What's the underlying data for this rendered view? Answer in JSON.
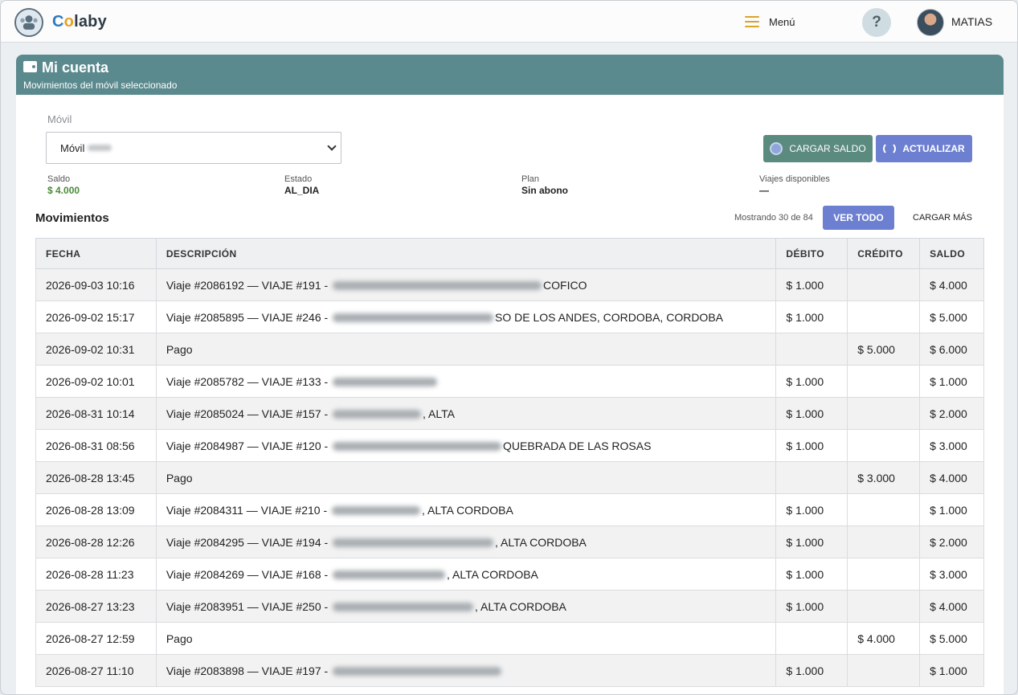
{
  "header": {
    "brand_c": "C",
    "brand_o": "o",
    "brand_rest": "laby",
    "menu_label": "Menú",
    "help_label": "?",
    "user_name": "MATIAS"
  },
  "card": {
    "title": "Mi cuenta",
    "subtitle": "Movimientos del móvil seleccionado",
    "field_label": "Móvil",
    "select_value": "Móvil",
    "charge_button": "CARGAR SALDO",
    "refresh_button": "ACTUALIZAR"
  },
  "stats": [
    {
      "label": "Saldo",
      "value": "$ 4.000"
    },
    {
      "label": "Estado",
      "value": "AL_DIA"
    },
    {
      "label": "Plan",
      "value": "Sin abono"
    },
    {
      "label": "Viajes disponibles",
      "value": "—"
    }
  ],
  "movements": {
    "title": "Movimientos",
    "showing": "Mostrando 30 de 84",
    "view_all": "VER TODO",
    "load_more": "CARGAR MÁS",
    "columns": [
      "FECHA",
      "DESCRIPCIÓN",
      "DÉBITO",
      "CRÉDITO",
      "SALDO"
    ],
    "rows": [
      {
        "date": "2026-09-03 10:16",
        "desc_pre": "Viaje #2086192 — VIAJE #191 - ",
        "desc_post": "COFICO",
        "debit": "$ 1.000",
        "credit": "",
        "balance": "$ 4.000"
      },
      {
        "date": "2026-09-02 15:17",
        "desc_pre": "Viaje #2085895 — VIAJE #246 - ",
        "desc_post": "SO DE LOS ANDES, CORDOBA, CORDOBA",
        "debit": "$ 1.000",
        "credit": "",
        "balance": "$ 5.000"
      },
      {
        "date": "2026-09-02 10:31",
        "desc_pre": "Pago",
        "desc_post": "",
        "debit": "",
        "credit": "$ 5.000",
        "balance": "$ 6.000"
      },
      {
        "date": "2026-09-02 10:01",
        "desc_pre": "Viaje #2085782 — VIAJE #133 - ",
        "desc_post": "",
        "debit": "$ 1.000",
        "credit": "",
        "balance": "$ 1.000"
      },
      {
        "date": "2026-08-31 10:14",
        "desc_pre": "Viaje #2085024 — VIAJE #157 - ",
        "desc_post": ", ALTA",
        "debit": "$ 1.000",
        "credit": "",
        "balance": "$ 2.000"
      },
      {
        "date": "2026-08-31 08:56",
        "desc_pre": "Viaje #2084987 — VIAJE #120 - ",
        "desc_post": "QUEBRADA DE LAS ROSAS",
        "debit": "$ 1.000",
        "credit": "",
        "balance": "$ 3.000"
      },
      {
        "date": "2026-08-28 13:45",
        "desc_pre": "Pago",
        "desc_post": "",
        "debit": "",
        "credit": "$ 3.000",
        "balance": "$ 4.000"
      },
      {
        "date": "2026-08-28 13:09",
        "desc_pre": "Viaje #2084311 — VIAJE #210 - ",
        "desc_post": ", ALTA CORDOBA",
        "debit": "$ 1.000",
        "credit": "",
        "balance": "$ 1.000"
      },
      {
        "date": "2026-08-28 12:26",
        "desc_pre": "Viaje #2084295 — VIAJE #194 - ",
        "desc_post": ", ALTA CORDOBA",
        "debit": "$ 1.000",
        "credit": "",
        "balance": "$ 2.000"
      },
      {
        "date": "2026-08-28 11:23",
        "desc_pre": "Viaje #2084269 — VIAJE #168 - ",
        "desc_post": ", ALTA CORDOBA",
        "debit": "$ 1.000",
        "credit": "",
        "balance": "$ 3.000"
      },
      {
        "date": "2026-08-27 13:23",
        "desc_pre": "Viaje #2083951 — VIAJE #250 - ",
        "desc_post": ", ALTA CORDOBA",
        "debit": "$ 1.000",
        "credit": "",
        "balance": "$ 4.000"
      },
      {
        "date": "2026-08-27 12:59",
        "desc_pre": "Pago",
        "desc_post": "",
        "debit": "",
        "credit": "$ 4.000",
        "balance": "$ 5.000"
      },
      {
        "date": "2026-08-27 11:10",
        "desc_pre": "Viaje #2083898 — VIAJE #197 - ",
        "desc_post": "",
        "debit": "$ 1.000",
        "credit": "",
        "balance": "$ 1.000"
      }
    ]
  },
  "colors": {
    "header_teal": "#5b8a8e",
    "button_blue": "#6c7fd0",
    "button_green": "#5b8a7e",
    "balance_green": "#4a8a3a",
    "accent_gold": "#d9a42a"
  },
  "icons": [
    "logo-icon",
    "hamburger-icon",
    "help-icon",
    "avatar",
    "wallet-icon",
    "coin-icon",
    "refresh-icon",
    "chevron-down-icon"
  ]
}
